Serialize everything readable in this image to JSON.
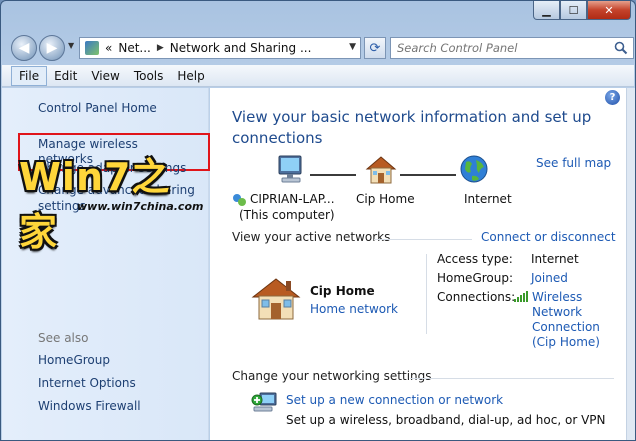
{
  "nav": {
    "address": {
      "chevron": "«",
      "segment_1": "Net...",
      "separator": "▶",
      "segment_2": "Network and Sharing ..."
    },
    "search_placeholder": "Search Control Panel"
  },
  "menu": [
    "File",
    "Edit",
    "View",
    "Tools",
    "Help"
  ],
  "sidebar": {
    "control_panel_home": "Control Panel Home",
    "manage_wireless": "Manage wireless networks",
    "change_adapter": "Change adapter settings",
    "change_sharing_1": "Change advanced sharing",
    "change_sharing_2": "settings",
    "see_also": "See also",
    "homegroup": "HomeGroup",
    "internet_options": "Internet Options",
    "windows_firewall": "Windows Firewall"
  },
  "watermark": {
    "title": "Win7之家",
    "url": "www.win7china.com"
  },
  "main": {
    "title": "View your basic network information and set up connections",
    "see_full_map": "See full map",
    "map": {
      "computer_name": "CIPRIAN-LAP...",
      "computer_sub": "(This computer)",
      "network": "Cip Home",
      "internet": "Internet"
    },
    "active_networks": {
      "heading": "View your active networks",
      "connect_link": "Connect or disconnect",
      "network_name": "Cip Home",
      "network_type": "Home network",
      "access_type_label": "Access type:",
      "access_type_value": "Internet",
      "homegroup_label": "HomeGroup:",
      "homegroup_value": "Joined",
      "connections_label": "Connections:",
      "connections_value": "Wireless Network Connection (Cip Home)"
    },
    "change_settings": {
      "heading": "Change your networking settings",
      "setup_link": "Set up a new connection or network",
      "setup_desc": "Set up a wireless, broadband, dial-up, ad hoc, or VPN"
    }
  }
}
